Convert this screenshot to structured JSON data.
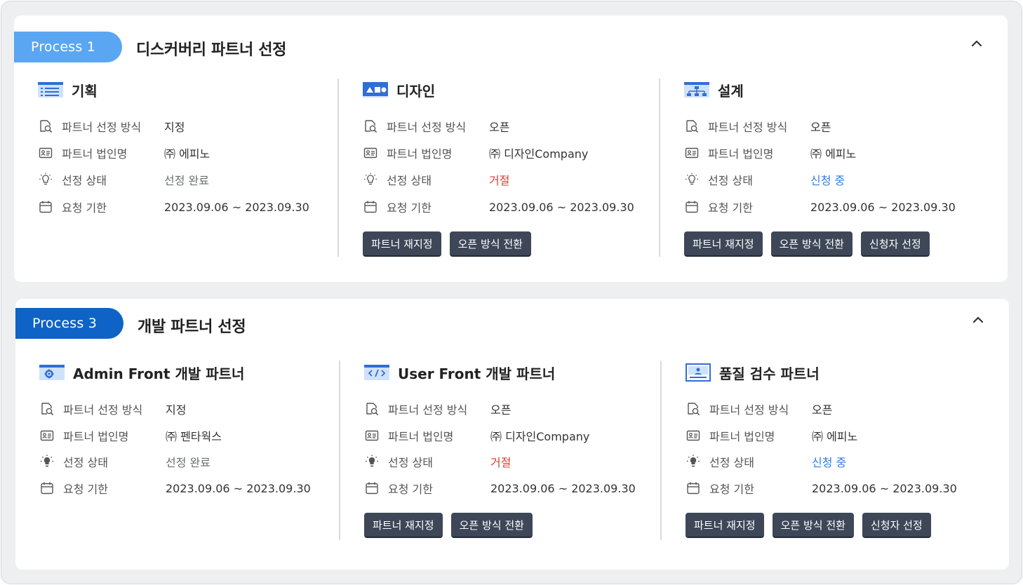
{
  "labels": {
    "method": "파트너 선정 방식",
    "company": "파트너 법인명",
    "status": "선정 상태",
    "deadline": "요청 기한"
  },
  "processes": [
    {
      "badge": "Process 1",
      "title": "디스커버리 파트너 선정",
      "columns": [
        {
          "title": "기획",
          "icon": "list-icon",
          "method": "지정",
          "company": "㈜ 에피노",
          "status": "선정 완료",
          "deadline": "2023.09.06 ~ 2023.09.30",
          "buttons": []
        },
        {
          "title": "디자인",
          "icon": "design-icon",
          "method": "오픈",
          "company": "㈜ 디자인Company",
          "status": "거절",
          "deadline": "2023.09.06 ~ 2023.09.30",
          "buttons": [
            "파트너 재지정",
            "오픈 방식 전환"
          ]
        },
        {
          "title": "설계",
          "icon": "sitemap-icon",
          "method": "오픈",
          "company": "㈜ 에피노",
          "status": "신청 중",
          "deadline": "2023.09.06 ~ 2023.09.30",
          "buttons": [
            "파트너 재지정",
            "오픈 방식 전환",
            "신청자 선정"
          ]
        }
      ]
    },
    {
      "badge": "Process 3",
      "title": "개발 파트너 선정",
      "columns": [
        {
          "title": "Admin Front 개발 파트너",
          "icon": "admin-gear-icon",
          "method": "지정",
          "company": "㈜ 펜타웍스",
          "status": "선정 완료",
          "deadline": "2023.09.06 ~ 2023.09.30",
          "buttons": []
        },
        {
          "title": "User Front 개발 파트너",
          "icon": "code-icon",
          "method": "오픈",
          "company": "㈜ 디자인Company",
          "status": "거절",
          "deadline": "2023.09.06 ~ 2023.09.30",
          "buttons": [
            "파트너 재지정",
            "오픈 방식 전환"
          ]
        },
        {
          "title": "품질 검수 파트너",
          "icon": "qa-monitor-icon",
          "method": "오픈",
          "company": "㈜ 에피노",
          "status": "신청 중",
          "deadline": "2023.09.06 ~ 2023.09.30",
          "buttons": [
            "파트너 재지정",
            "오픈 방식 전환",
            "신청자 선정"
          ]
        }
      ]
    }
  ],
  "colors": {
    "process1_badge": "#5aa6f3",
    "process3_badge": "#0f63c6",
    "status_rejected": "#e53935",
    "status_applying": "#2f7de1",
    "button_bg": "#3e4758"
  }
}
